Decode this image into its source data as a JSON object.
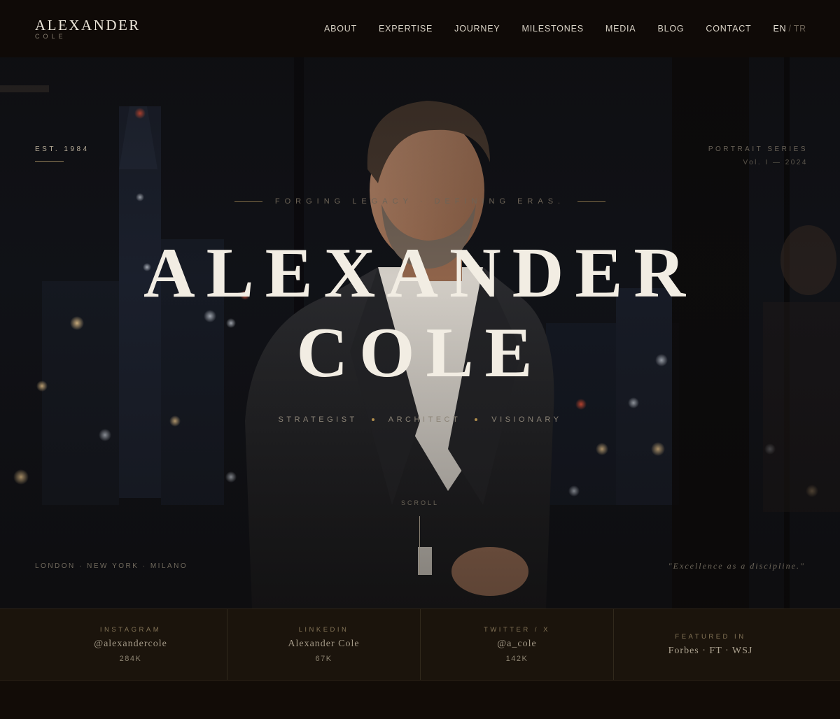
{
  "nav": {
    "brand_name": "ALEXANDER",
    "brand_sub": "COLE",
    "items": [
      {
        "label": "ABOUT"
      },
      {
        "label": "EXPERTISE"
      },
      {
        "label": "JOURNEY"
      },
      {
        "label": "MILESTONES"
      },
      {
        "label": "MEDIA"
      },
      {
        "label": "BLOG"
      },
      {
        "label": "CONTACT"
      }
    ],
    "lang_active": "EN",
    "lang_sep": "/",
    "lang_other": "TR"
  },
  "hero": {
    "est": "EST. 1984",
    "series_title": "PORTRAIT SERIES",
    "series_vol": "Vol. I — 2024",
    "tagline": "FORGING LEGACY · DEFINING ERAS.",
    "first_name": "ALEXANDER",
    "last_name": "COLE",
    "roles": [
      "STRATEGIST",
      "ARCHITECT",
      "VISIONARY"
    ],
    "scroll_label": "SCROLL",
    "cities": "LONDON · NEW YORK · MILANO",
    "quote": "\"Excellence as a discipline.\""
  },
  "social": [
    {
      "platform": "INSTAGRAM",
      "handle": "@alexandercole",
      "count": "284K"
    },
    {
      "platform": "LINKEDIN",
      "handle": "Alexander Cole",
      "count": "67K"
    },
    {
      "platform": "TWITTER / X",
      "handle": "@a_cole",
      "count": "142K"
    },
    {
      "platform": "FEATURED IN",
      "handle": "Forbes · FT · WSJ"
    }
  ],
  "colors": {
    "accent_gold": "#b08d4c",
    "background": "#0f0a07",
    "headline": "#f2ede3"
  }
}
